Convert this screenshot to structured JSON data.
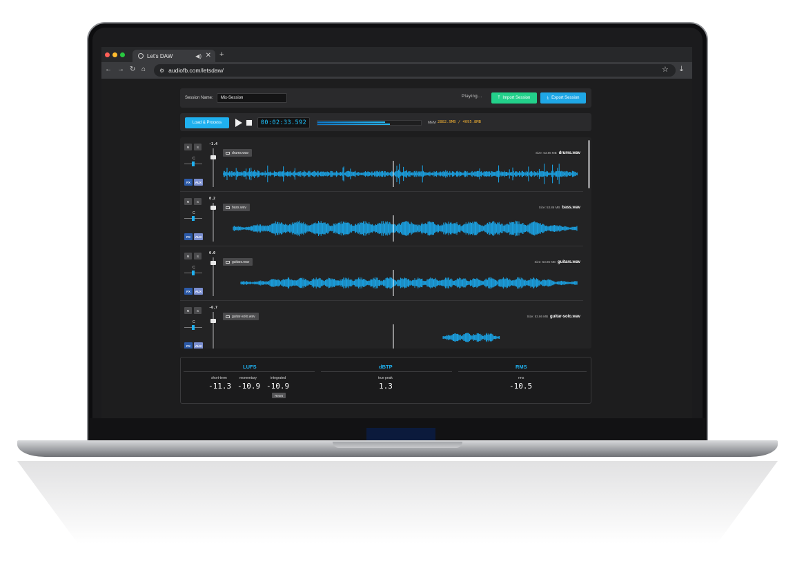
{
  "browser": {
    "tab_title": "Let's DAW",
    "new_tab": "+",
    "tab_close": "✕",
    "url": "audiofb.com/letsdaw/",
    "nav": {
      "back": "←",
      "forward": "→",
      "reload": "↻",
      "home": "⌂"
    },
    "star": "☆",
    "download": "⤓"
  },
  "session": {
    "name_label": "Session Name:",
    "name_value": "Mix-Session",
    "status": "Playing...",
    "import_label": "Import Session",
    "export_label": "Export Session",
    "import_color": "#23d18b",
    "export_color": "#1fa7e6"
  },
  "transport": {
    "load_label": "Load & Process",
    "timecode": "00:02:33.592",
    "progress_fraction": 0.65,
    "buffer_fraction": 0.7,
    "mem_label": "MEM",
    "mem_value": "2882.9MB / 4095.8MB"
  },
  "tracks": [
    {
      "mute": "M",
      "solo": "S",
      "pan": "C",
      "fx": "FX",
      "aux": "AUX",
      "volume": "-1.4",
      "fader": 0.2,
      "file_button": "drums.wav",
      "size_label": "Size: 53.86 MB",
      "file_name": "drums.wav"
    },
    {
      "mute": "M",
      "solo": "S",
      "pan": "C",
      "fx": "FX",
      "aux": "AUX",
      "volume": "0.2",
      "fader": 0.08,
      "file_button": "bass.wav",
      "size_label": "Size: 53.86 MB",
      "file_name": "bass.wav"
    },
    {
      "mute": "M",
      "solo": "S",
      "pan": "C",
      "fx": "FX",
      "aux": "AUX",
      "volume": "0.0",
      "fader": 0.1,
      "file_button": "guitars.wav",
      "size_label": "Size: 53.86 MB",
      "file_name": "guitars.wav"
    },
    {
      "mute": "M",
      "solo": "S",
      "pan": "C",
      "fx": "FX",
      "aux": "AUX",
      "volume": "-6.7",
      "fader": 0.2,
      "file_button": "guitar-solo.wav",
      "size_label": "Size: 53.86 MB",
      "file_name": "guitar-solo.wav"
    }
  ],
  "meters": {
    "lufs": {
      "title": "LUFS",
      "short_term_label": "short-term",
      "momentary_label": "momentary",
      "integrated_label": "integrated",
      "short_term": "-11.3",
      "momentary": "-10.9",
      "integrated": "-10.9",
      "reset_label": "Reset"
    },
    "dbtp": {
      "title": "dBTP",
      "label": "true peak",
      "value": "1.3"
    },
    "rms": {
      "title": "RMS",
      "label": "rms",
      "value": "-10.5"
    }
  },
  "colors": {
    "accent": "#1fb0ef",
    "wave": "#1aa9ee",
    "mem_value": "#f2b134"
  }
}
